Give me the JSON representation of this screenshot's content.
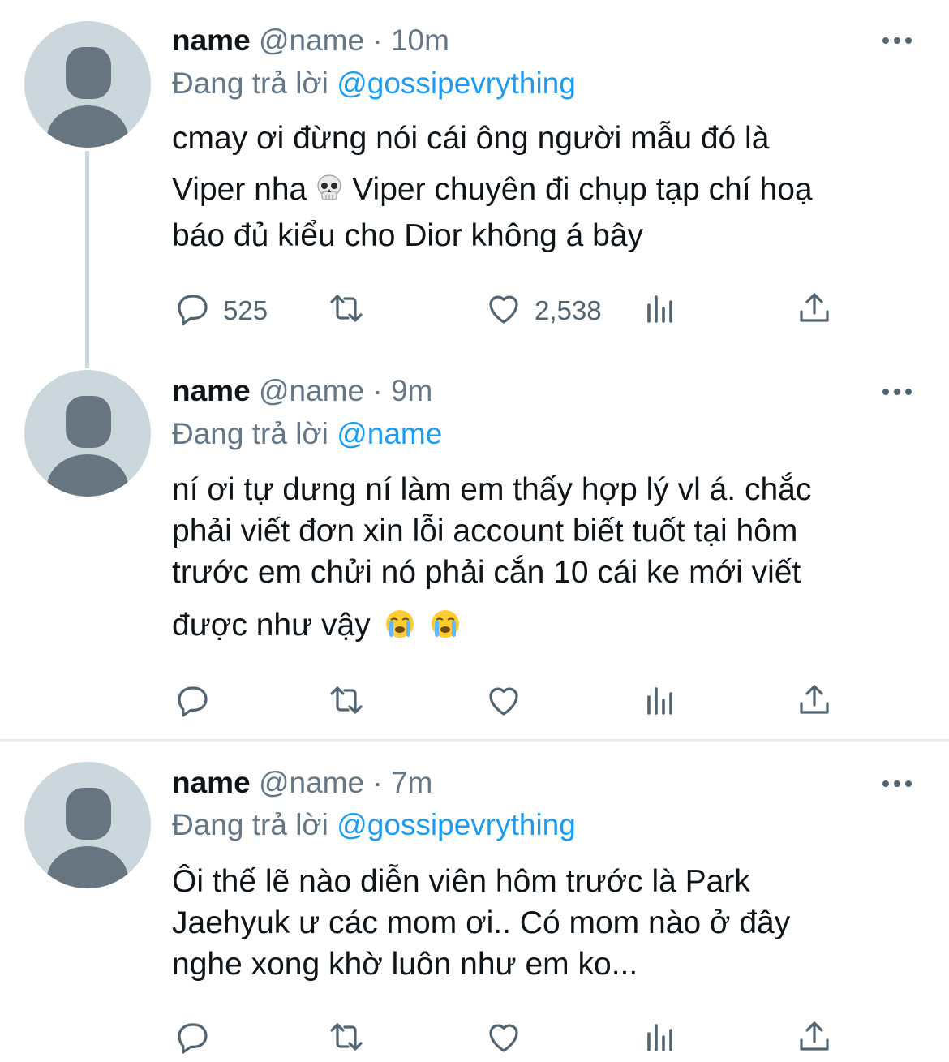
{
  "tweets": [
    {
      "name": "name",
      "handle": "@name",
      "sep": "·",
      "time": "10m",
      "reply_prefix": "Đang trả lời",
      "reply_to": "@gossipevrything",
      "lines": [
        "cmay ơi đừng nói cái ông người mẫu đó là",
        "Viper nha",
        "Viper chuyên đi chụp tạp chí hoạ",
        "báo đủ kiểu cho Dior không á bây"
      ],
      "emoji": "skull",
      "replies": "525",
      "retweets": "",
      "likes": "2,538"
    },
    {
      "name": "name",
      "handle": "@name",
      "sep": "·",
      "time": "9m",
      "reply_prefix": "Đang trả lời",
      "reply_to": "@name",
      "lines": [
        "ní ơi tự dưng ní làm em thấy hợp lý vl á. chắc",
        "phải viết đơn xin lỗi account biết tuốt tại hôm",
        "trước em chửi nó phải cắn 10 cái ke mới viết",
        "được như vậy"
      ],
      "emoji": "loudly-crying-face",
      "replies": "",
      "retweets": "",
      "likes": ""
    },
    {
      "name": "name",
      "handle": "@name",
      "sep": "·",
      "time": "7m",
      "reply_prefix": "Đang trả lời",
      "reply_to": "@gossipevrything",
      "lines": [
        "Ôi thế lẽ nào diễn viên hôm trước là Park",
        "Jaehyuk ư các mom ơi.. Có mom nào ở đây",
        "nghe xong khờ luôn như em ko..."
      ],
      "replies": "",
      "retweets": "",
      "likes": ""
    }
  ],
  "icons": {
    "reply": "reply-icon",
    "retweet": "retweet-icon",
    "like": "heart-icon",
    "views": "analytics-icon",
    "share": "share-icon",
    "more": "more-icon"
  },
  "colors": {
    "mention": "#1d9bf0",
    "secondary_text": "#657786",
    "icon": "#536471",
    "avatar_bg": "#ccd6dd",
    "avatar_fg": "#66757f"
  }
}
